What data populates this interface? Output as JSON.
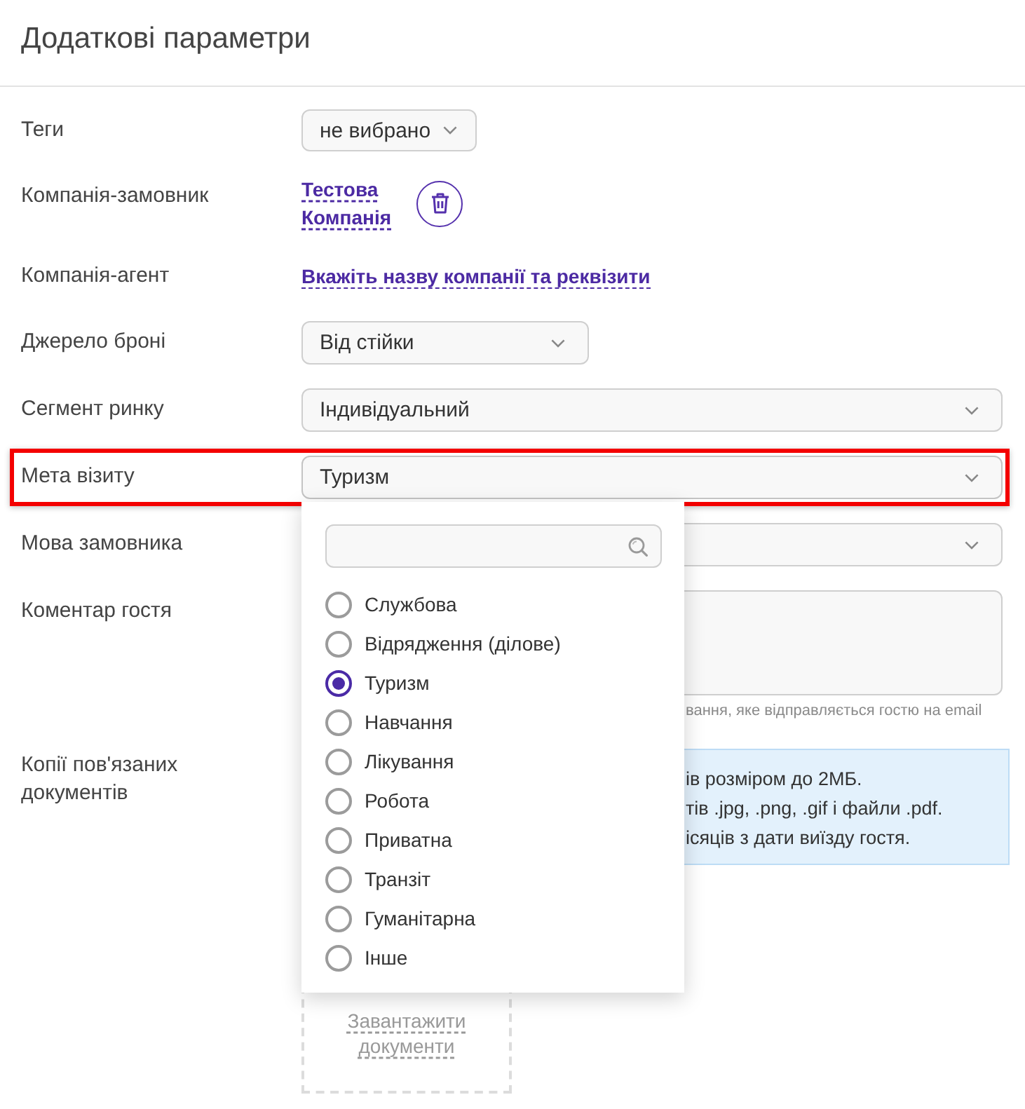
{
  "title": "Додаткові параметри",
  "fields": [
    {
      "kind": "picker",
      "label": "Теги",
      "value": "не вибрано",
      "highlighted": false
    },
    {
      "kind": "company",
      "label": "Компанія-замовник",
      "value": "Тестова Компанія",
      "highlighted": false
    },
    {
      "kind": "link",
      "label": "Компанія-агент",
      "value": "Вкажіть назву компанії та реквізити",
      "highlighted": false
    },
    {
      "kind": "dropdown",
      "label": "Джерело броні",
      "value": "Від стійки",
      "highlighted": false
    },
    {
      "kind": "select",
      "label": "Сегмент ринку",
      "value": "Індивідуальний",
      "highlighted": false
    },
    {
      "kind": "select",
      "label": "Мета візиту",
      "value": "Туризм",
      "expanded": true,
      "highlighted": true,
      "options": [
        {
          "label": "Службова",
          "selected": false
        },
        {
          "label": "Відрядження (ділове)",
          "selected": false
        },
        {
          "label": "Туризм",
          "selected": true
        },
        {
          "label": "Навчання",
          "selected": false
        },
        {
          "label": "Лікування",
          "selected": false
        },
        {
          "label": "Робота",
          "selected": false
        },
        {
          "label": "Приватна",
          "selected": false
        },
        {
          "label": "Транзіт",
          "selected": false
        },
        {
          "label": "Гуманітарна",
          "selected": false
        },
        {
          "label": "Інше",
          "selected": false
        }
      ]
    },
    {
      "kind": "select",
      "label": "Мова замовника",
      "highlighted": false
    },
    {
      "kind": "textarea",
      "label": "Коментар гостя",
      "hint": "вання, яке відправляється гостю на email",
      "highlighted": false
    },
    {
      "kind": "upload",
      "label": "Копії пов'язаних документів",
      "info": [
        "ів розміром до 2МБ.",
        "тів .jpg, .png, .gif і файли .pdf.",
        "ісяців з дати виїзду гостя."
      ],
      "button": "Завантажити документи",
      "highlighted": false
    }
  ]
}
